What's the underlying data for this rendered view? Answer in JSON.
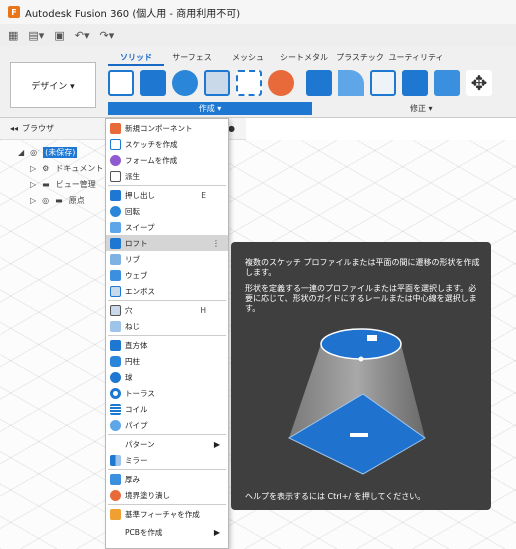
{
  "window": {
    "title": "Autodesk Fusion 360 (個人用 - 商用利用不可)"
  },
  "ribbon": {
    "workspace_label": "デザイン ▾",
    "tabs": [
      "ソリッド",
      "サーフェス",
      "メッシュ",
      "シートメタル",
      "プラスチック",
      "ユーティリティ"
    ],
    "active_tab": "ソリッド",
    "create_group_label": "作成 ▾",
    "modify_group_label": "修正 ▾"
  },
  "browser": {
    "title": "ブラウザ",
    "items": [
      "(未保存)",
      "ドキュメント",
      "ビュー管理",
      "原点"
    ]
  },
  "menu": {
    "items": [
      {
        "label": "新規コンポーネント",
        "shortcut": "",
        "arrow": ""
      },
      {
        "label": "スケッチを作成",
        "shortcut": "",
        "arrow": ""
      },
      {
        "label": "フォームを作成",
        "shortcut": "",
        "arrow": ""
      },
      {
        "label": "派生",
        "shortcut": "",
        "arrow": ""
      },
      {
        "label": "押し出し",
        "shortcut": "E",
        "arrow": ""
      },
      {
        "label": "回転",
        "shortcut": "",
        "arrow": ""
      },
      {
        "label": "スイープ",
        "shortcut": "",
        "arrow": ""
      },
      {
        "label": "ロフト",
        "shortcut": "",
        "arrow": "⋮"
      },
      {
        "label": "リブ",
        "shortcut": "",
        "arrow": ""
      },
      {
        "label": "ウェブ",
        "shortcut": "",
        "arrow": ""
      },
      {
        "label": "エンボス",
        "shortcut": "",
        "arrow": ""
      },
      {
        "label": "穴",
        "shortcut": "H",
        "arrow": ""
      },
      {
        "label": "ねじ",
        "shortcut": "",
        "arrow": ""
      },
      {
        "label": "直方体",
        "shortcut": "",
        "arrow": ""
      },
      {
        "label": "円柱",
        "shortcut": "",
        "arrow": ""
      },
      {
        "label": "球",
        "shortcut": "",
        "arrow": ""
      },
      {
        "label": "トーラス",
        "shortcut": "",
        "arrow": ""
      },
      {
        "label": "コイル",
        "shortcut": "",
        "arrow": ""
      },
      {
        "label": "パイプ",
        "shortcut": "",
        "arrow": ""
      },
      {
        "label": "パターン",
        "shortcut": "",
        "arrow": "▶"
      },
      {
        "label": "ミラー",
        "shortcut": "",
        "arrow": ""
      },
      {
        "label": "厚み",
        "shortcut": "",
        "arrow": ""
      },
      {
        "label": "境界塗り潰し",
        "shortcut": "",
        "arrow": ""
      },
      {
        "label": "基準フィーチャを作成",
        "shortcut": "",
        "arrow": ""
      },
      {
        "label": "PCBを作成",
        "shortcut": "",
        "arrow": "▶"
      }
    ]
  },
  "tooltip": {
    "para1": "複数のスケッチ プロファイルまたは平面の間に遷移の形状を作成します。",
    "para2": "形状を定義する一連のプロファイルまたは平面を選択します。必要に応じて、形状のガイドにするレールまたは中心線を選択します。",
    "footer": "ヘルプを表示するには Ctrl+/ を押してください。"
  },
  "colors": {
    "accent": "#1e77d1",
    "tooltip_bg": "#3f3f3f",
    "highlight": "#d5d5d5"
  }
}
